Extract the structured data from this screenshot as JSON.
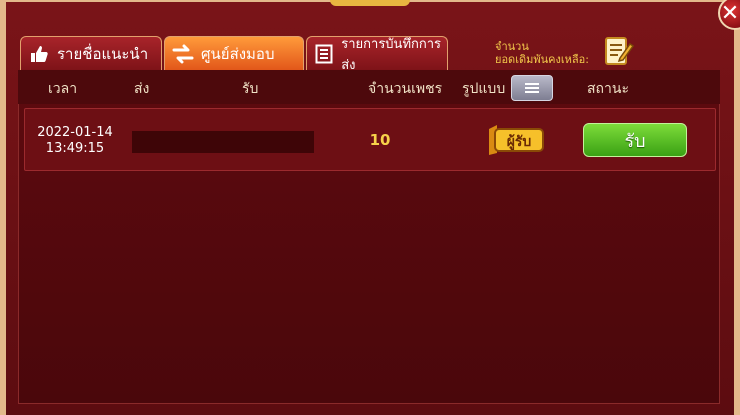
{
  "tabs": [
    {
      "label": "รายชื่อแนะนำ",
      "icon": "thumbs-up-icon",
      "active": false
    },
    {
      "label": "ศูนย์ส่งมอบ",
      "icon": "swap-arrows-icon",
      "active": true
    },
    {
      "label": "รายการบันทึกการส่ง",
      "icon": "list-document-icon",
      "active": false
    }
  ],
  "balance": {
    "line1": "จำนวน",
    "line2": "ยอดเดิมพันคงเหลือ:"
  },
  "columns": {
    "time": "เวลา",
    "send": "ส่ง",
    "receive": "รับ",
    "amount": "จำนวนเพชร",
    "type": "รูปแบบ",
    "status": "สถานะ"
  },
  "rows": [
    {
      "date": "2022-01-14",
      "time": "13:49:15",
      "amount": "10",
      "badge": "ผู้รับ",
      "action": "รับ"
    }
  ],
  "colors": {
    "accent": "#e2571a",
    "success": "#3aa114",
    "gold": "#f2c84b",
    "panel": "#5e0a0f"
  }
}
